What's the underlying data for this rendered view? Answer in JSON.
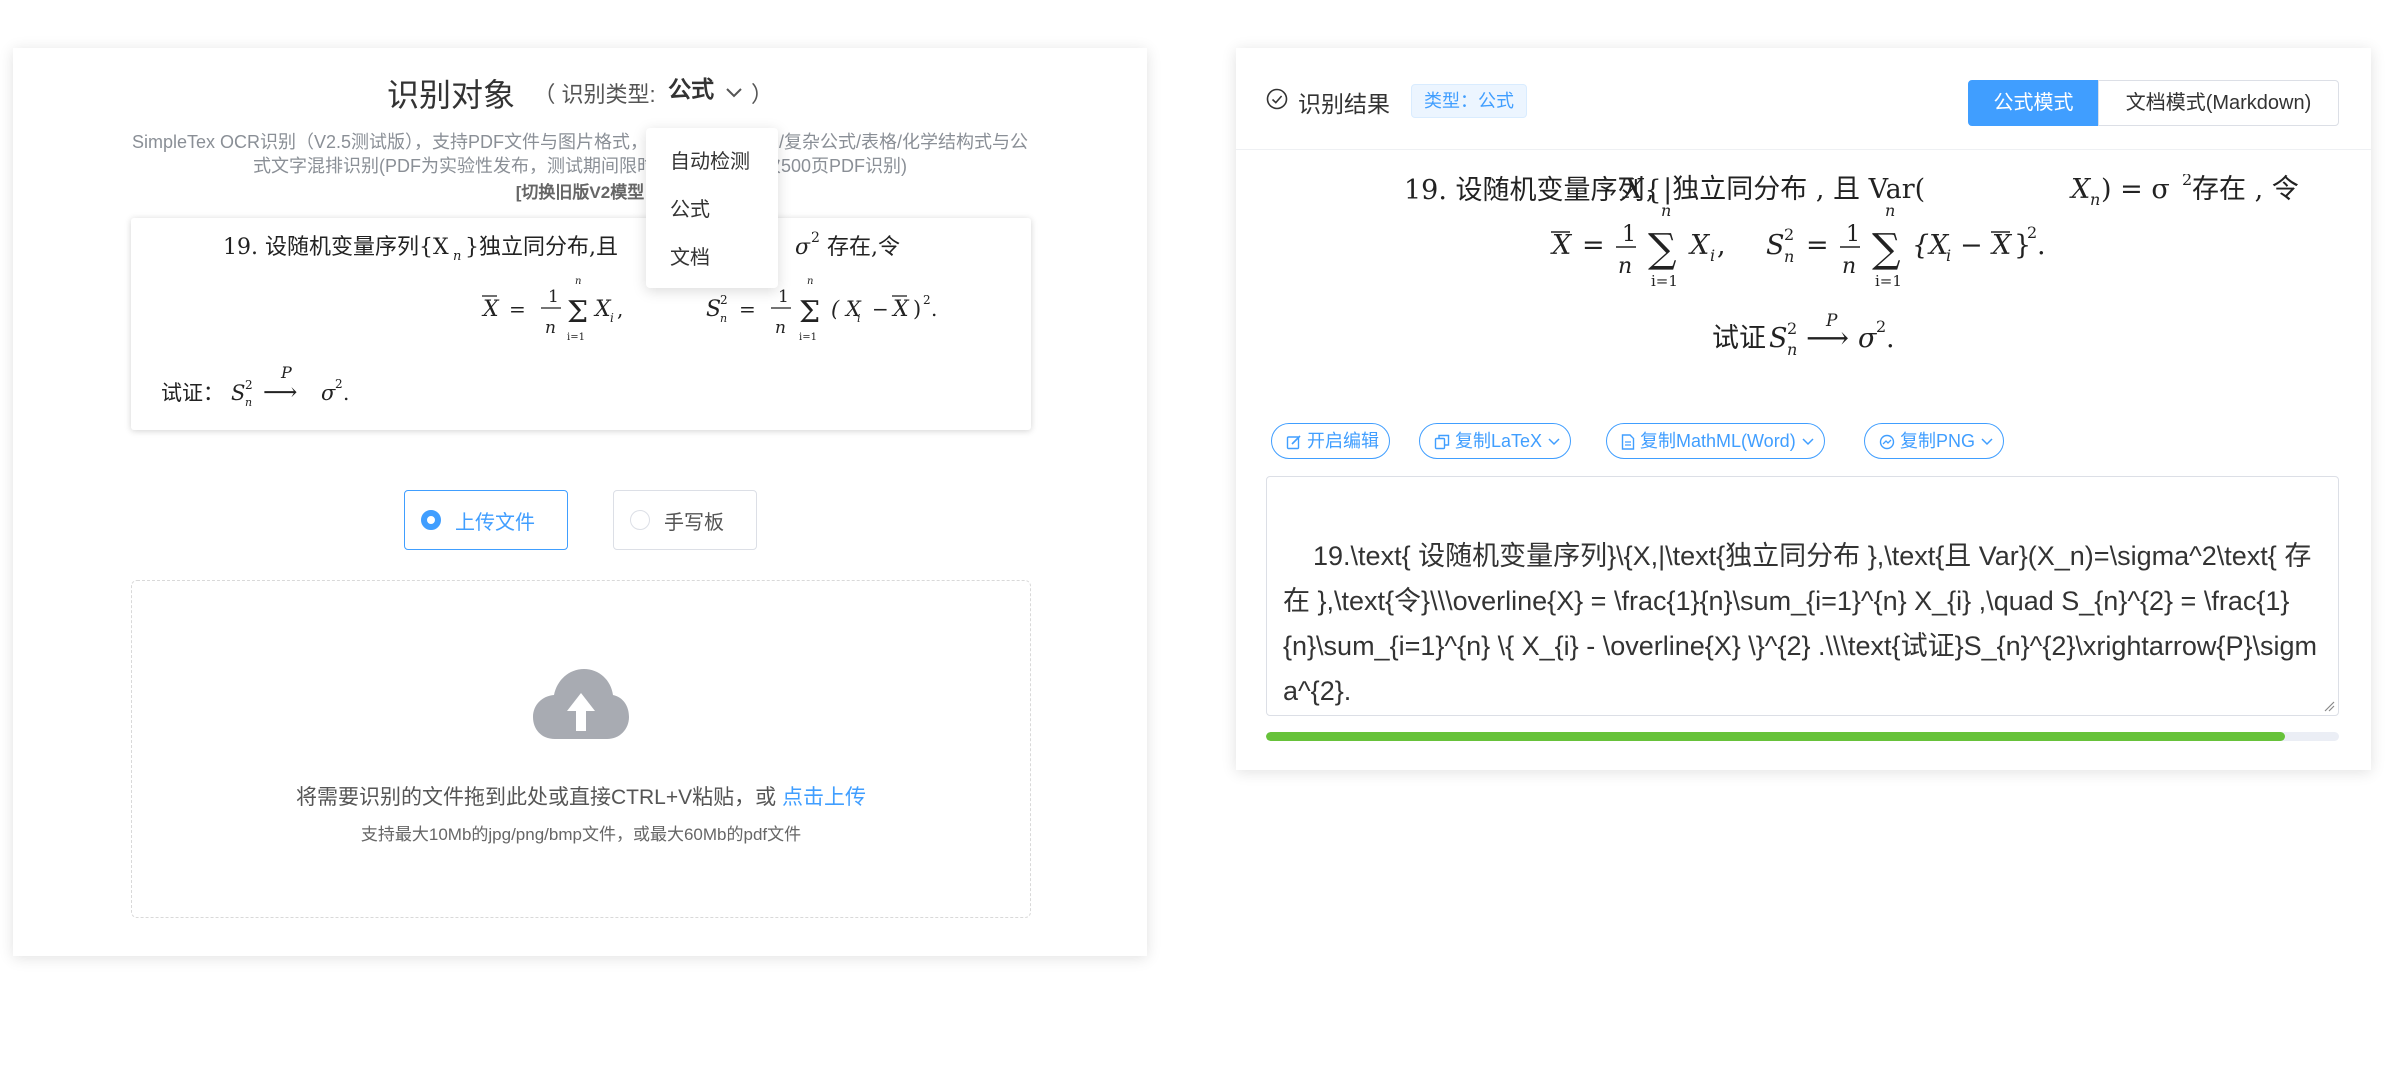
{
  "left": {
    "title": "识别对象",
    "type_label": "（ 识别类型:",
    "type_value": "公式",
    "type_close": "）",
    "description": "SimpleTex OCR识别（V2.5测试版），支持PDF文件与图片格式，支持多语言/手写/复杂公式/表格/化学结构式与公式文字混排识别(PDF为实验性发布，测试期间限时开放，最大单次500页PDF识别)",
    "legacy_link": "[切换旧版V2模型",
    "dropdown": [
      "自动检测",
      "公式",
      "文档"
    ],
    "preview": {
      "line1": "19. 设随机变量序列{X",
      "line1_sub": "n",
      "line1_b": "}独立同分布,且",
      "line1_c": "σ",
      "line1_d": "存在,令",
      "xbar": "X",
      "eq": "=",
      "one": "1",
      "n": "n",
      "sum": "Σ",
      "i1": "i=1",
      "xi": "X",
      "i": "i",
      "comma": ",",
      "s": "S",
      "pow2": "2",
      "xminus": "( X",
      "minus": "−",
      "close": ")",
      "dot": ".",
      "prove": "试证：",
      "arrow_label": "P",
      "arrow": "⟶",
      "sigma": "σ"
    },
    "radio_upload": "上传文件",
    "radio_handwrite": "手写板",
    "drop_text": "将需要识别的文件拖到此处或直接CTRL+V粘贴，或 ",
    "drop_link": "点击上传",
    "drop_tip": "支持最大10Mb的jpg/png/bmp文件，或最大60Mb的pdf文件"
  },
  "right": {
    "title": "识别结果",
    "tag": "类型：公式",
    "mode_formula": "公式模式",
    "mode_doc": "文档模式(Markdown)",
    "render": {
      "l1_a": "19. 设随机变量序列{",
      "l1_x": "X",
      "l1_b": ", |独立同分布 , 且 Var(",
      "l1_xn": "X",
      "l1_n": "n",
      "l1_c": ") = σ",
      "l1_2": "2",
      "l1_d": " 存在 , 令",
      "l2_xbar": "X",
      "l2_eq": "=",
      "l2_1": "1",
      "l2_n": "n",
      "l2_sum": "∑",
      "l2_up": "n",
      "l2_low": "i=1",
      "l2_x": "X",
      "l2_i": "i",
      "l2_comma": ",",
      "l2_s": "S",
      "l2_s2": "2",
      "l2_sn": "n",
      "l2_eq2": "=",
      "l2_brace": "{X",
      "l2_bi": "i",
      "l2_minus": "−",
      "l2_xb2": "X",
      "l2_close": "}",
      "l2_end": "2",
      "l2_dot": ".",
      "l3_a": "试证",
      "l3_s": "S",
      "l3_2": "2",
      "l3_n": "n",
      "l3_p": "P",
      "l3_arrow": "⟶",
      "l3_sig": "σ",
      "l3_sig2": "2",
      "l3_dot": "."
    },
    "btn_edit": "开启编辑",
    "btn_latex": "复制LaTeX",
    "btn_mathml": "复制MathML(Word)",
    "btn_png": "复制PNG",
    "latex": "19.\\text{ 设随机变量序列}\\{X,|\\text{独立同分布 },\\text{且 Var}(X_n)=\\sigma^2\\text{ 存在 },\\text{令}\\\\\\overline{X} = \\frac{1}{n}\\sum_{i=1}^{n} X_{i} ,\\quad S_{n}^{2} = \\frac{1}{n}\\sum_{i=1}^{n} \\{ X_{i} - \\overline{X} \\}^{2} .\\\\\\text{试证}S_{n}^{2}\\xrightarrow{P}\\sigma^{2}.",
    "progress": 0.95,
    "progress_color": "#67c23a",
    "accent_color": "#409eff"
  }
}
